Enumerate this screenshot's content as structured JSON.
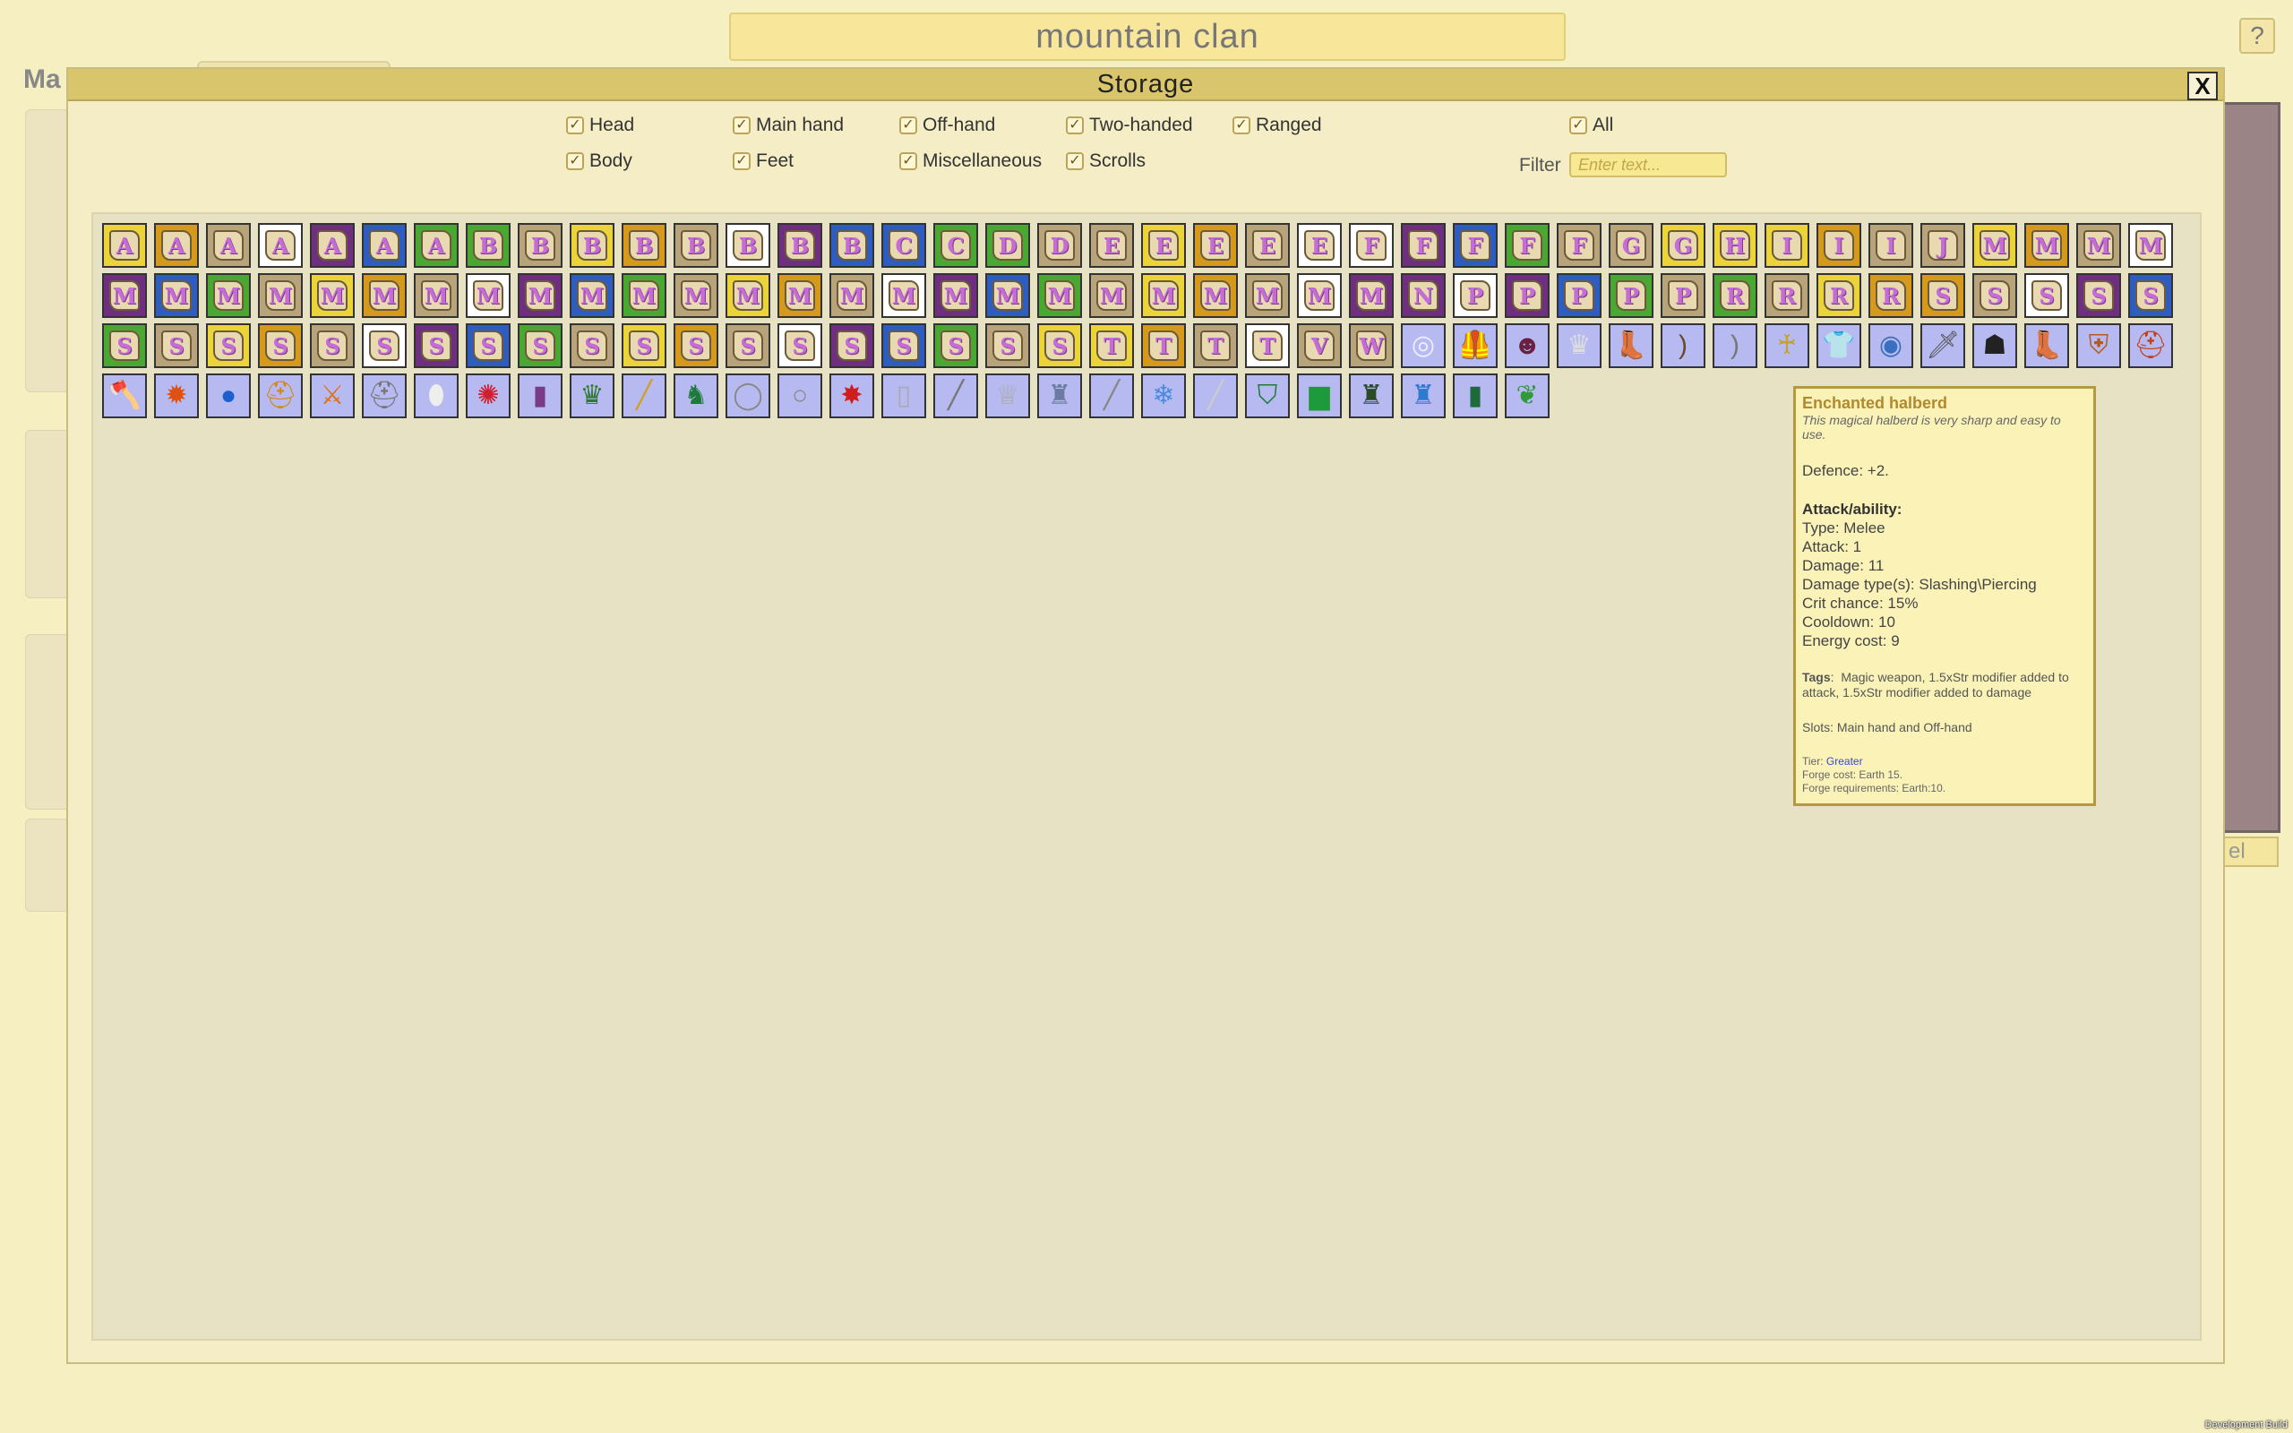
{
  "header": {
    "title": "mountain clan",
    "help_label": "?"
  },
  "background": {
    "heading": "Ma",
    "cancel_fragment": "el",
    "dev_build": "Development Build"
  },
  "storage": {
    "title": "Storage",
    "close_label": "X",
    "filters": [
      {
        "label": "Head",
        "checked": true
      },
      {
        "label": "Main hand",
        "checked": true
      },
      {
        "label": "Off-hand",
        "checked": true
      },
      {
        "label": "Two-handed",
        "checked": true
      },
      {
        "label": "Ranged",
        "checked": true
      },
      {
        "label": "All",
        "checked": true
      },
      {
        "label": "Body",
        "checked": true
      },
      {
        "label": "Feet",
        "checked": true
      },
      {
        "label": "Miscellaneous",
        "checked": true
      },
      {
        "label": "Scrolls",
        "checked": true
      }
    ],
    "filter_label": "Filter",
    "filter_placeholder": "Enter text...",
    "scroll_letters": "AAAAAAABBBBBBBBCCDDEEEEEFFFFFGGHIIIJMMMMMMMMMMMMMMMMMMMMMMMMMMMMMNPPPPPRRRRSSSSSSSSSSSSSSSSSSSSSSSSTTTTVW",
    "scroll_colors": [
      "#d59a1c",
      "#ead43a",
      "#b8a47a",
      "#4aa832",
      "#2e5cbf",
      "#6e2f7e",
      "#ffffff",
      "#b8a47a"
    ],
    "equipment_icons": [
      {
        "name": "ring-icon",
        "glyph": "◎",
        "color": "#eef"
      },
      {
        "name": "leather-armor-icon",
        "glyph": "🦺",
        "color": "#a0704a"
      },
      {
        "name": "demon-mask-icon",
        "glyph": "☻",
        "color": "#6a2040"
      },
      {
        "name": "tiara-icon",
        "glyph": "♛",
        "color": "#ddd"
      },
      {
        "name": "boot-icon",
        "glyph": "👢",
        "color": "#6b4a2b"
      },
      {
        "name": "bow-icon",
        "glyph": ")",
        "color": "#6b4a2b"
      },
      {
        "name": "longbow-icon",
        "glyph": ")",
        "color": "#777"
      },
      {
        "name": "amulet-icon",
        "glyph": "♰",
        "color": "#c8a030"
      },
      {
        "name": "chainmail-icon",
        "glyph": "👕",
        "color": "#ddd"
      },
      {
        "name": "round-shield-icon",
        "glyph": "◉",
        "color": "#3a6fbf"
      },
      {
        "name": "sword-icon",
        "glyph": "🗡",
        "color": "#555"
      },
      {
        "name": "black-armor-icon",
        "glyph": "☗",
        "color": "#222"
      },
      {
        "name": "brown-boots-icon",
        "glyph": "👢",
        "color": "#6b3a1b"
      },
      {
        "name": "wooden-shield-icon",
        "glyph": "⛨",
        "color": "#b55a1e"
      },
      {
        "name": "fire-helm-icon",
        "glyph": "⛑",
        "color": "#c0401e"
      },
      {
        "name": "halberd-icon",
        "glyph": "🪓",
        "color": "#555"
      },
      {
        "name": "fire-orb-icon",
        "glyph": "✹",
        "color": "#e05010"
      },
      {
        "name": "blue-orb-icon",
        "glyph": "●",
        "color": "#1e5fcf"
      },
      {
        "name": "golden-helm-icon",
        "glyph": "⛑",
        "color": "#d08a1e"
      },
      {
        "name": "golden-sword-icon",
        "glyph": "⚔",
        "color": "#e07010"
      },
      {
        "name": "knight-helm-icon",
        "glyph": "⛑",
        "color": "#777"
      },
      {
        "name": "white-shield-icon",
        "glyph": "⬮",
        "color": "#eee"
      },
      {
        "name": "red-orb-icon",
        "glyph": "✺",
        "color": "#cf1e2e"
      },
      {
        "name": "purple-robe-icon",
        "glyph": "▮",
        "color": "#7a3a86"
      },
      {
        "name": "green-crown-icon",
        "glyph": "♛",
        "color": "#2e7a2e"
      },
      {
        "name": "golden-staff-icon",
        "glyph": "╱",
        "color": "#d0a020"
      },
      {
        "name": "unicorn-banner-icon",
        "glyph": "♞",
        "color": "#1e7a3a"
      },
      {
        "name": "silver-amulet-icon",
        "glyph": "◯",
        "color": "#888"
      },
      {
        "name": "silver-ring-icon",
        "glyph": "○",
        "color": "#888"
      },
      {
        "name": "red-shield-icon",
        "glyph": "✸",
        "color": "#cf1e1e"
      },
      {
        "name": "silver-pillar-icon",
        "glyph": "▯",
        "color": "#aaa"
      },
      {
        "name": "spear-icon",
        "glyph": "╱",
        "color": "#777"
      },
      {
        "name": "silver-crown-icon",
        "glyph": "♕",
        "color": "#aaa"
      },
      {
        "name": "plate-armor-icon",
        "glyph": "♜",
        "color": "#6a7aa0"
      },
      {
        "name": "thin-staff-icon",
        "glyph": "╱",
        "color": "#888"
      },
      {
        "name": "ice-crystal-icon",
        "glyph": "❄",
        "color": "#4a8ae0"
      },
      {
        "name": "mace-icon",
        "glyph": "╱",
        "color": "#ccc"
      },
      {
        "name": "green-shield-icon",
        "glyph": "⛉",
        "color": "#1e7a3a"
      },
      {
        "name": "green-potion-icon",
        "glyph": "▆",
        "color": "#1e9a3a"
      },
      {
        "name": "green-tunic-icon",
        "glyph": "♜",
        "color": "#2a4a2a"
      },
      {
        "name": "blue-tunic-icon",
        "glyph": "♜",
        "color": "#2e7acf"
      },
      {
        "name": "green-cloak-icon",
        "glyph": "▮",
        "color": "#1e6a3a"
      },
      {
        "name": "leaf-crown-icon",
        "glyph": "❦",
        "color": "#2e9a3a"
      }
    ]
  },
  "tooltip": {
    "name": "Enchanted halberd",
    "description": "This magical halberd is very sharp and easy to use.",
    "defence": "Defence: +2.",
    "ability_header": "Attack/ability:",
    "stats": [
      "Type: Melee",
      "Attack: 1",
      "Damage: 11",
      "Damage type(s): Slashing\\Piercing",
      "Crit chance: 15%",
      "Cooldown: 10",
      "Energy cost: 9"
    ],
    "tags_label": "Tags",
    "tags_text": "Magic weapon, 1.5xStr modifier added to attack, 1.5xStr modifier added to damage",
    "slots": "Slots: Main hand and Off-hand",
    "tier_label": "Tier:",
    "tier_value": "Greater",
    "forge_cost": "Forge cost: Earth 15.",
    "forge_requirements": "Forge requirements: Earth:10."
  }
}
